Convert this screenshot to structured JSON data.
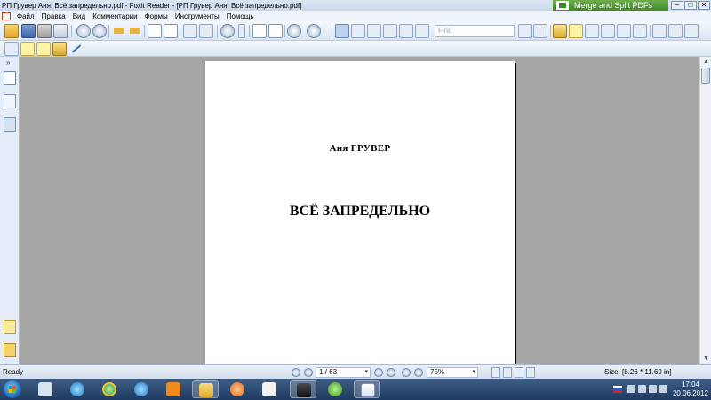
{
  "window": {
    "title": "РП Грувер Аня. Всё запредельно.pdf - Foxit Reader - [РП Грувер Аня. Всё запредельно.pdf]",
    "merge_banner": "Merge and Split PDFs",
    "min_symbol": "–",
    "max_symbol": "□",
    "close_symbol": "✕"
  },
  "menu": {
    "items": [
      "Файл",
      "Правка",
      "Вид",
      "Комментарии",
      "Формы",
      "Инструменты",
      "Помощь"
    ]
  },
  "toolbar": {
    "find_placeholder": "Find"
  },
  "document": {
    "author": "Аня  ГРУВЕР",
    "title": "ВСЁ ЗАПРЕДЕЛЬНО"
  },
  "status": {
    "ready": "Ready",
    "page_indicator": "1 / 63",
    "zoom": "75%",
    "page_size": "Size: [8.26 * 11.69 in]"
  },
  "clock": {
    "time": "17:04",
    "date": "20.06.2012"
  }
}
